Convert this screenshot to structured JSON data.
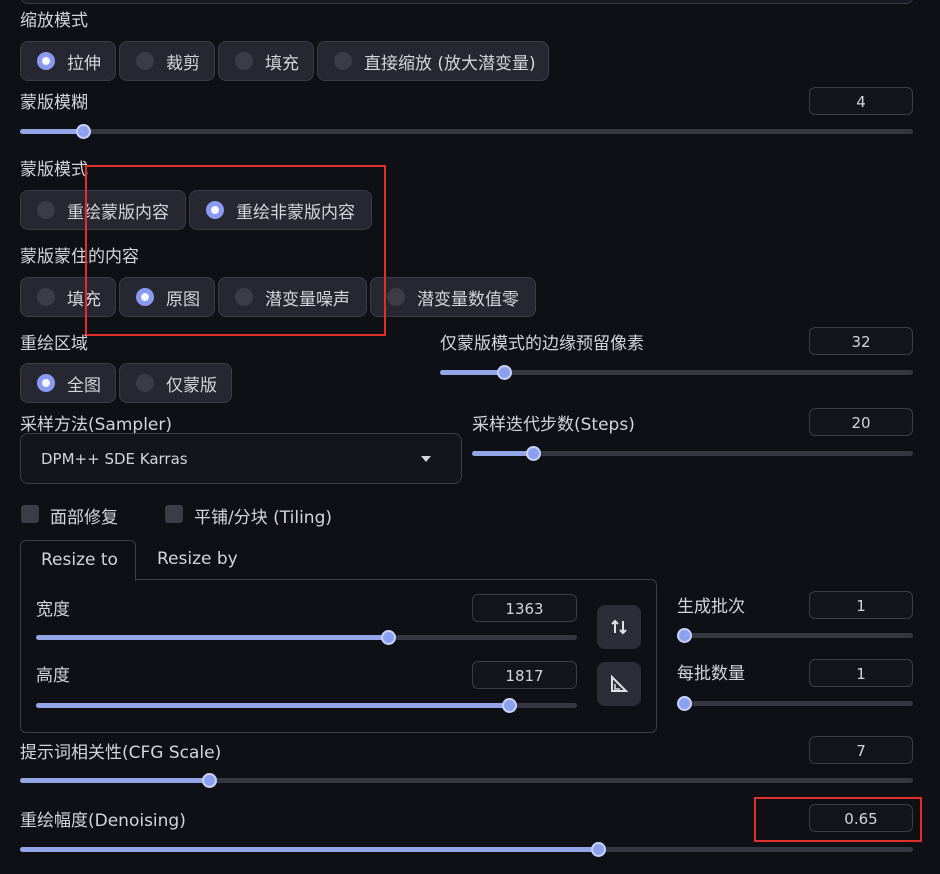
{
  "resize_mode": {
    "label": "缩放模式",
    "options": [
      "拉伸",
      "裁剪",
      "填充",
      "直接缩放 (放大潜变量)"
    ],
    "selected": 0
  },
  "mask_blur": {
    "label": "蒙版模糊",
    "value": "4",
    "fraction": 0.07
  },
  "mask_mode": {
    "label": "蒙版模式",
    "options": [
      "重绘蒙版内容",
      "重绘非蒙版内容"
    ],
    "selected": 1
  },
  "masked_content": {
    "label": "蒙版蒙住的内容",
    "options": [
      "填充",
      "原图",
      "潜变量噪声",
      "潜变量数值零"
    ],
    "selected": 1
  },
  "inpaint_area": {
    "label": "重绘区域",
    "options": [
      "全图",
      "仅蒙版"
    ],
    "selected": 0
  },
  "only_masked_padding": {
    "label": "仅蒙版模式的边缘预留像素",
    "value": "32",
    "fraction": 0.125
  },
  "sampler": {
    "label": "采样方法(Sampler)",
    "value": "DPM++ SDE Karras"
  },
  "steps": {
    "label": "采样迭代步数(Steps)",
    "value": "20",
    "fraction": 0.14
  },
  "checkboxes": {
    "restore_faces": "面部修复",
    "tiling": "平铺/分块 (Tiling)"
  },
  "resize_tabs": {
    "tab1": "Resize to",
    "tab2": "Resize by"
  },
  "width": {
    "label": "宽度",
    "value": "1363",
    "fraction": 0.65
  },
  "height": {
    "label": "高度",
    "value": "1817",
    "fraction": 0.87
  },
  "batch_count": {
    "label": "生成批次",
    "value": "1",
    "fraction": 0.0
  },
  "batch_size": {
    "label": "每批数量",
    "value": "1",
    "fraction": 0.0
  },
  "cfg_scale": {
    "label": "提示词相关性(CFG Scale)",
    "value": "7",
    "fraction": 0.21
  },
  "denoising": {
    "label": "重绘幅度(Denoising)",
    "value": "0.65",
    "fraction": 0.65
  },
  "icons": {
    "swap": "swap-dimensions-icon",
    "ratio": "aspect-ratio-icon",
    "dropdown": "chevron-down-icon"
  },
  "colors": {
    "accent": "#8aa1ef",
    "highlight": "#e0302a",
    "background": "#0f1016"
  }
}
